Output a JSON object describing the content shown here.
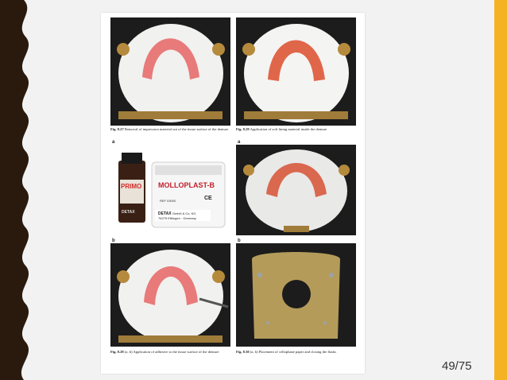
{
  "slide": {
    "page_number": "49/75"
  },
  "figures": {
    "fig827": {
      "number": "Fig. 8.27",
      "caption": "Removal of impression material out of the tissue surface of the denture"
    },
    "fig829": {
      "number": "Fig. 8.29",
      "caption": "Application of soft lining material inside the denture"
    },
    "fig828": {
      "number": "Fig. 8.28",
      "caption": "(a, b) Application of adhesive to the tissue surface of the denture",
      "label_a": "a",
      "label_b": "b"
    },
    "fig830": {
      "number": "Fig. 8.30",
      "caption": "(a, b) Placement of cellophane paper and closing the flasks",
      "label_a": "a",
      "label_b": "b"
    }
  },
  "products": {
    "primo": {
      "brand": "PRIMO",
      "maker": "DETAX"
    },
    "molloplast": {
      "brand": "MOLLOPLAST-B",
      "ref": "REF 03000",
      "ce": "CE",
      "maker": "DETAX",
      "company": "GmbH & Co. KG",
      "address": "76275 Ettlingen · Germany"
    }
  },
  "colors": {
    "accent": "#f5b323",
    "left_band": "#2a1a0e",
    "photo_bg": "#1c1c1c"
  }
}
